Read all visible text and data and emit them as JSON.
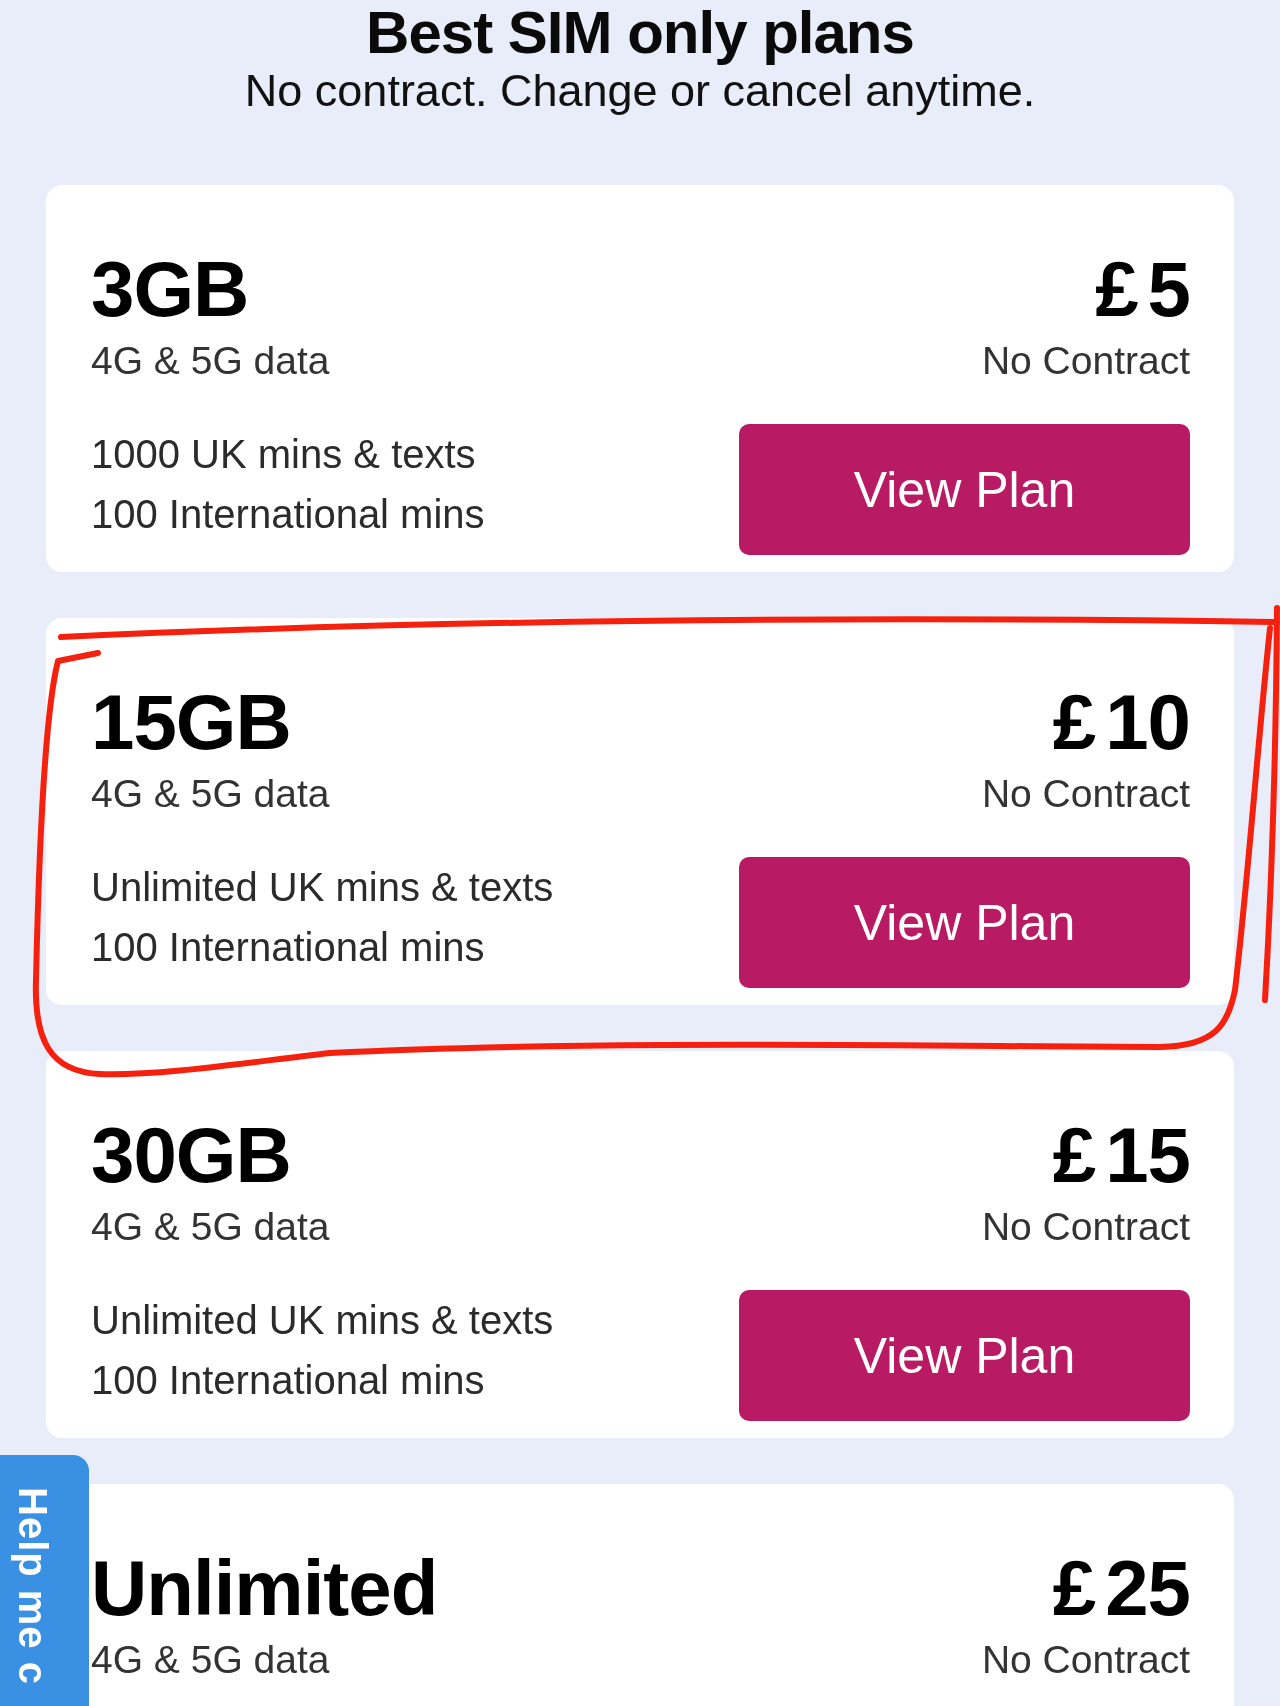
{
  "header": {
    "title": "Best SIM only plans",
    "subtitle": "No contract. Change or cancel anytime."
  },
  "plans": [
    {
      "data": "3GB",
      "network": "4G & 5G data",
      "features": [
        "1000 UK mins & texts",
        "100 International mins"
      ],
      "currency": "£",
      "amount": "5",
      "term": "No Contract",
      "button": "View Plan",
      "circled": false
    },
    {
      "data": "15GB",
      "network": "4G & 5G data",
      "features": [
        "Unlimited UK mins & texts",
        "100 International mins"
      ],
      "currency": "£",
      "amount": "10",
      "term": "No Contract",
      "button": "View Plan",
      "circled": true
    },
    {
      "data": "30GB",
      "network": "4G & 5G data",
      "features": [
        "Unlimited UK mins & texts",
        "100 International mins"
      ],
      "currency": "£",
      "amount": "15",
      "term": "No Contract",
      "button": "View Plan",
      "circled": false
    },
    {
      "data": "Unlimited",
      "network": "4G & 5G data",
      "currency": "£",
      "amount": "25",
      "term": "No Contract",
      "circled": false
    }
  ],
  "help_tab": {
    "label": "Help me c"
  }
}
